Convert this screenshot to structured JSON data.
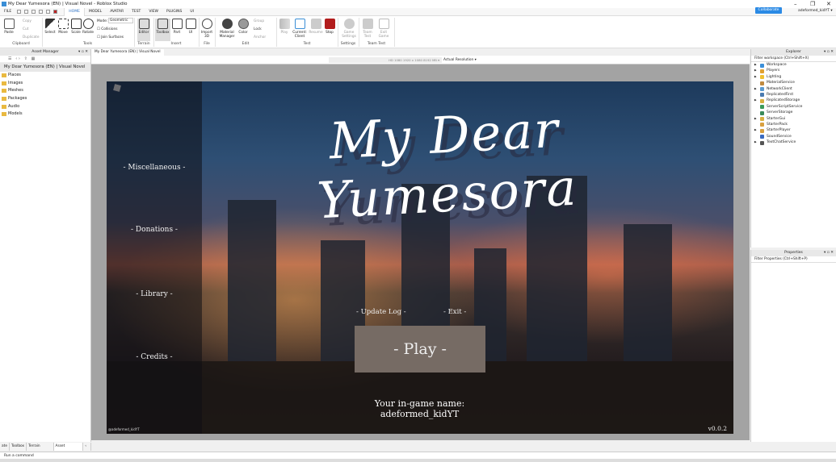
{
  "window": {
    "title": "My Dear Yumesora (EN) | Visual Novel - Roblox Studio",
    "minimize": "–",
    "maximize": "❐",
    "close": "✕"
  },
  "menu": {
    "file": "FILE",
    "tabs": [
      "HOME",
      "MODEL",
      "AVATAR",
      "TEST",
      "VIEW",
      "PLUGINS",
      "UI"
    ],
    "active": "HOME",
    "collaborate": "Collaborate",
    "user": "adeformed_kidYT ▾"
  },
  "ribbon": {
    "clipboard": {
      "paste": "Paste",
      "copy": "Copy",
      "cut": "Cut",
      "duplicate": "Duplicate",
      "label": "Clipboard"
    },
    "tools": {
      "select": "Select",
      "move": "Move",
      "scale": "Scale",
      "rotate": "Rotate",
      "mode_label": "Mode:",
      "mode_value": "Geometric",
      "collisions": "Collisions",
      "join_surfaces": "Join Surfaces",
      "label": "Tools"
    },
    "terrain": {
      "editor": "Editor",
      "label": "Terrain"
    },
    "insert": {
      "toolbox": "Toolbox",
      "part": "Part",
      "ui": "UI",
      "label": "Insert"
    },
    "file": {
      "import3d": "Import 3D",
      "label": "File"
    },
    "edit": {
      "material": "Material Manager",
      "color": "Color",
      "group": "Group",
      "lock": "Lock",
      "anchor": "Anchor",
      "label": "Edit"
    },
    "test": {
      "play": "Play",
      "current_client": "Current: Client",
      "resume": "Resume",
      "stop": "Stop",
      "label": "Test"
    },
    "settings": {
      "game_settings": "Game Settings",
      "label": "Settings"
    },
    "team_test": {
      "team_test": "Team Test",
      "exit_game": "Exit Game",
      "label": "Team Test"
    }
  },
  "asset_manager": {
    "title": "Asset Manager",
    "project": "My Dear Yumesora (EN) | Visual Novel",
    "items": [
      "Places",
      "Images",
      "Meshes",
      "Packages",
      "Audio",
      "Models"
    ]
  },
  "document_tab": "My Dear Yumesora (EN) | Visual Novel",
  "view_header": {
    "device": "HD 1080   1920 x 1080   8192 MB ▾",
    "resolution": "Actual Resolution ▾"
  },
  "game": {
    "title": "My Dear Yumesora",
    "side_menu": [
      "- Miscellaneous -",
      "- Donations -",
      "- Library -",
      "- Credits -"
    ],
    "update_log": "- Update Log -",
    "exit": "- Exit -",
    "play": "- Play -",
    "name_label": "Your in-game name:",
    "name_value": "adeformed_kidYT",
    "credit": "@adeformed_kidYT",
    "version": "v0.0.2"
  },
  "explorer": {
    "title": "Explorer",
    "filter": "Filter workspace (Ctrl+Shift+X)",
    "items": [
      {
        "name": "Workspace",
        "expand": true,
        "color": "#3b8fd8"
      },
      {
        "name": "Players",
        "expand": true,
        "color": "#e0a030"
      },
      {
        "name": "Lighting",
        "expand": true,
        "color": "#f0c030"
      },
      {
        "name": "MaterialService",
        "expand": false,
        "color": "#c08a40"
      },
      {
        "name": "NetworkClient",
        "expand": true,
        "color": "#5a9ad0"
      },
      {
        "name": "ReplicatedFirst",
        "expand": false,
        "color": "#4a7ab0"
      },
      {
        "name": "ReplicatedStorage",
        "expand": true,
        "color": "#d8b040"
      },
      {
        "name": "ServerScriptService",
        "expand": false,
        "color": "#3a9a5a"
      },
      {
        "name": "ServerStorage",
        "expand": false,
        "color": "#3a8a5a"
      },
      {
        "name": "StarterGui",
        "expand": true,
        "color": "#d8b040"
      },
      {
        "name": "StarterPack",
        "expand": false,
        "color": "#d8a040"
      },
      {
        "name": "StarterPlayer",
        "expand": true,
        "color": "#d8a040"
      },
      {
        "name": "SoundService",
        "expand": false,
        "color": "#3a6ac0"
      },
      {
        "name": "TextChatService",
        "expand": true,
        "color": "#555555"
      }
    ]
  },
  "properties": {
    "title": "Properties",
    "filter": "Filter Properties (Ctrl+Shift+P)"
  },
  "bottom_tabs": [
    "ate",
    "Toolbox",
    "Terrain Editor",
    "Asset Manager"
  ],
  "command": {
    "placeholder": "Run a command"
  }
}
